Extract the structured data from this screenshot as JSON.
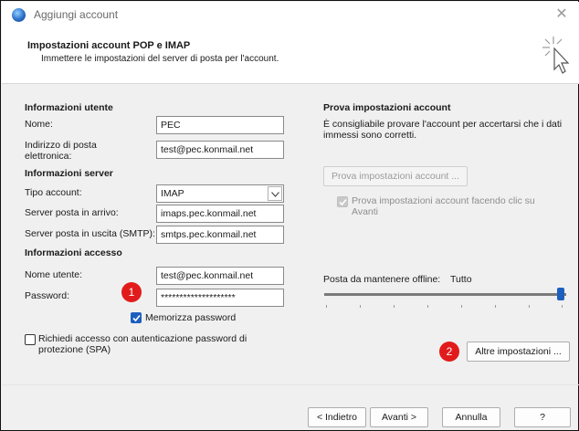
{
  "window": {
    "title": "Aggiungi account",
    "close_icon": "close-icon"
  },
  "header": {
    "title": "Impostazioni account POP e IMAP",
    "subtitle": "Immettere le impostazioni del server di posta per l'account."
  },
  "left": {
    "user_info_heading": "Informazioni utente",
    "name_label": "Nome:",
    "name_value": "PEC",
    "email_label_line1": "Indirizzo di posta",
    "email_label_line2": "elettronica:",
    "email_value": "test@pec.konmail.net",
    "server_info_heading": "Informazioni server",
    "account_type_label": "Tipo account:",
    "account_type_value": "IMAP",
    "incoming_label": "Server posta in arrivo:",
    "incoming_value": "imaps.pec.konmail.net",
    "outgoing_label": "Server posta in uscita (SMTP):",
    "outgoing_value": "smtps.pec.konmail.net",
    "access_info_heading": "Informazioni accesso",
    "username_label": "Nome utente:",
    "username_value": "test@pec.konmail.net",
    "password_label": "Password:",
    "password_value": "********************",
    "remember_password_label": "Memorizza password",
    "remember_password_checked": true,
    "spa_label_line1": "Richiedi accesso con autenticazione password di",
    "spa_label_line2": "protezione (SPA)",
    "spa_checked": false
  },
  "right": {
    "test_heading": "Prova impostazioni account",
    "test_desc_line1": "È consigliabile provare l'account per accertarsi che i dati",
    "test_desc_line2": "immessi sono corretti.",
    "test_button": "Prova impostazioni account ...",
    "auto_test_label_line1": "Prova impostazioni account facendo clic su",
    "auto_test_label_line2": "Avanti",
    "auto_test_checked": true,
    "offline_label": "Posta da mantenere offline:",
    "offline_value": "Tutto",
    "more_settings_button": "Altre impostazioni ..."
  },
  "badges": {
    "badge1": "1",
    "badge2": "2",
    "color": "#e11b1b"
  },
  "footer": {
    "back_button": "< Indietro",
    "next_button": "Avanti >",
    "cancel_button": "Annulla",
    "help_button": "?"
  },
  "colors": {
    "accent": "#1d5fbf"
  }
}
